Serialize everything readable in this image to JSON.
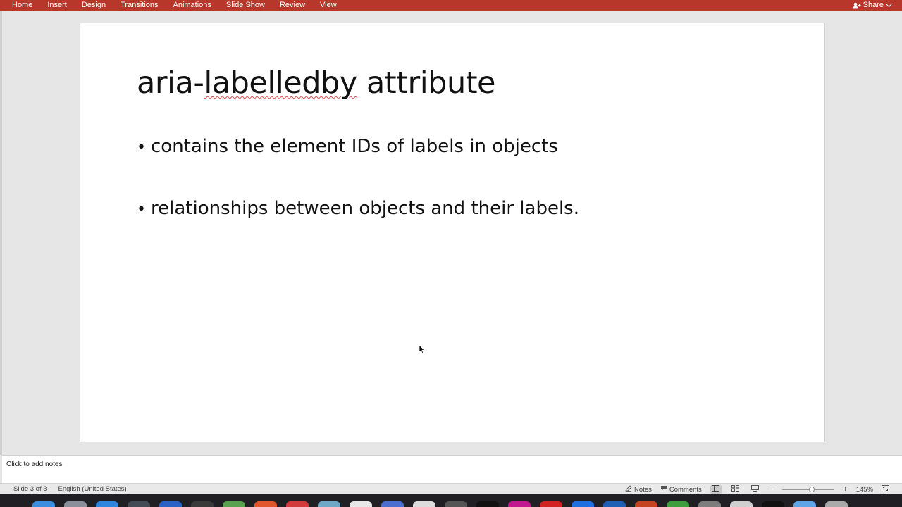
{
  "ribbon": {
    "tabs": [
      "Home",
      "Insert",
      "Design",
      "Transitions",
      "Animations",
      "Slide Show",
      "Review",
      "View"
    ],
    "share_label": "Share"
  },
  "slide": {
    "title_part1": "aria-",
    "title_squiggle": "labelledby",
    "title_part2": " attribute",
    "bullets": [
      "contains the element IDs of labels in objects",
      "relationships between objects and their labels."
    ],
    "bullet_glyph": "•"
  },
  "notes": {
    "placeholder": "Click to add notes"
  },
  "statusbar": {
    "slide_indicator": "Slide 3 of 3",
    "language": "English (United States)",
    "notes_label": "Notes",
    "comments_label": "Comments",
    "zoom_minus": "−",
    "zoom_plus": "+",
    "zoom_level": "145%"
  },
  "colors": {
    "ribbon": "#b7382a",
    "spell_error": "#d9534f"
  },
  "dock": {
    "icons": [
      {
        "name": "finder-icon",
        "color": "#3b8de0"
      },
      {
        "name": "launchpad-icon",
        "color": "#8a8f99"
      },
      {
        "name": "safari-icon",
        "color": "#2e86de"
      },
      {
        "name": "photo-icon",
        "color": "#444b55"
      },
      {
        "name": "word-icon",
        "color": "#2b63c4"
      },
      {
        "name": "app-icon-dark",
        "color": "#3a3a3a"
      },
      {
        "name": "app-icon-green",
        "color": "#59a14f"
      },
      {
        "name": "app-icon-orange",
        "color": "#e2562e"
      },
      {
        "name": "app-icon-red",
        "color": "#d13b3b"
      },
      {
        "name": "preview-icon",
        "color": "#6fa8c7"
      },
      {
        "name": "notes-app-icon",
        "color": "#e8e8e8"
      },
      {
        "name": "app-icon-blue",
        "color": "#4a6fd1"
      },
      {
        "name": "app-icon-white",
        "color": "#dcdcdc"
      },
      {
        "name": "app-icon-gray",
        "color": "#555"
      },
      {
        "name": "app-icon-black",
        "color": "#111"
      },
      {
        "name": "app-icon-magenta",
        "color": "#c2188f"
      },
      {
        "name": "acrobat-icon",
        "color": "#d22222"
      },
      {
        "name": "app-icon-blue2",
        "color": "#1f6fe0"
      },
      {
        "name": "outlook-icon",
        "color": "#1f5fb4"
      },
      {
        "name": "powerpoint-icon",
        "color": "#c64322"
      },
      {
        "name": "download-icon",
        "color": "#3e9e3e"
      },
      {
        "name": "settings-icon",
        "color": "#7d7d7d"
      },
      {
        "name": "printer-icon",
        "color": "#cfcfcf"
      },
      {
        "name": "terminal-icon",
        "color": "#111"
      },
      {
        "name": "folder-icon",
        "color": "#5ea5e8"
      },
      {
        "name": "trash-icon",
        "color": "#aaa"
      }
    ]
  }
}
